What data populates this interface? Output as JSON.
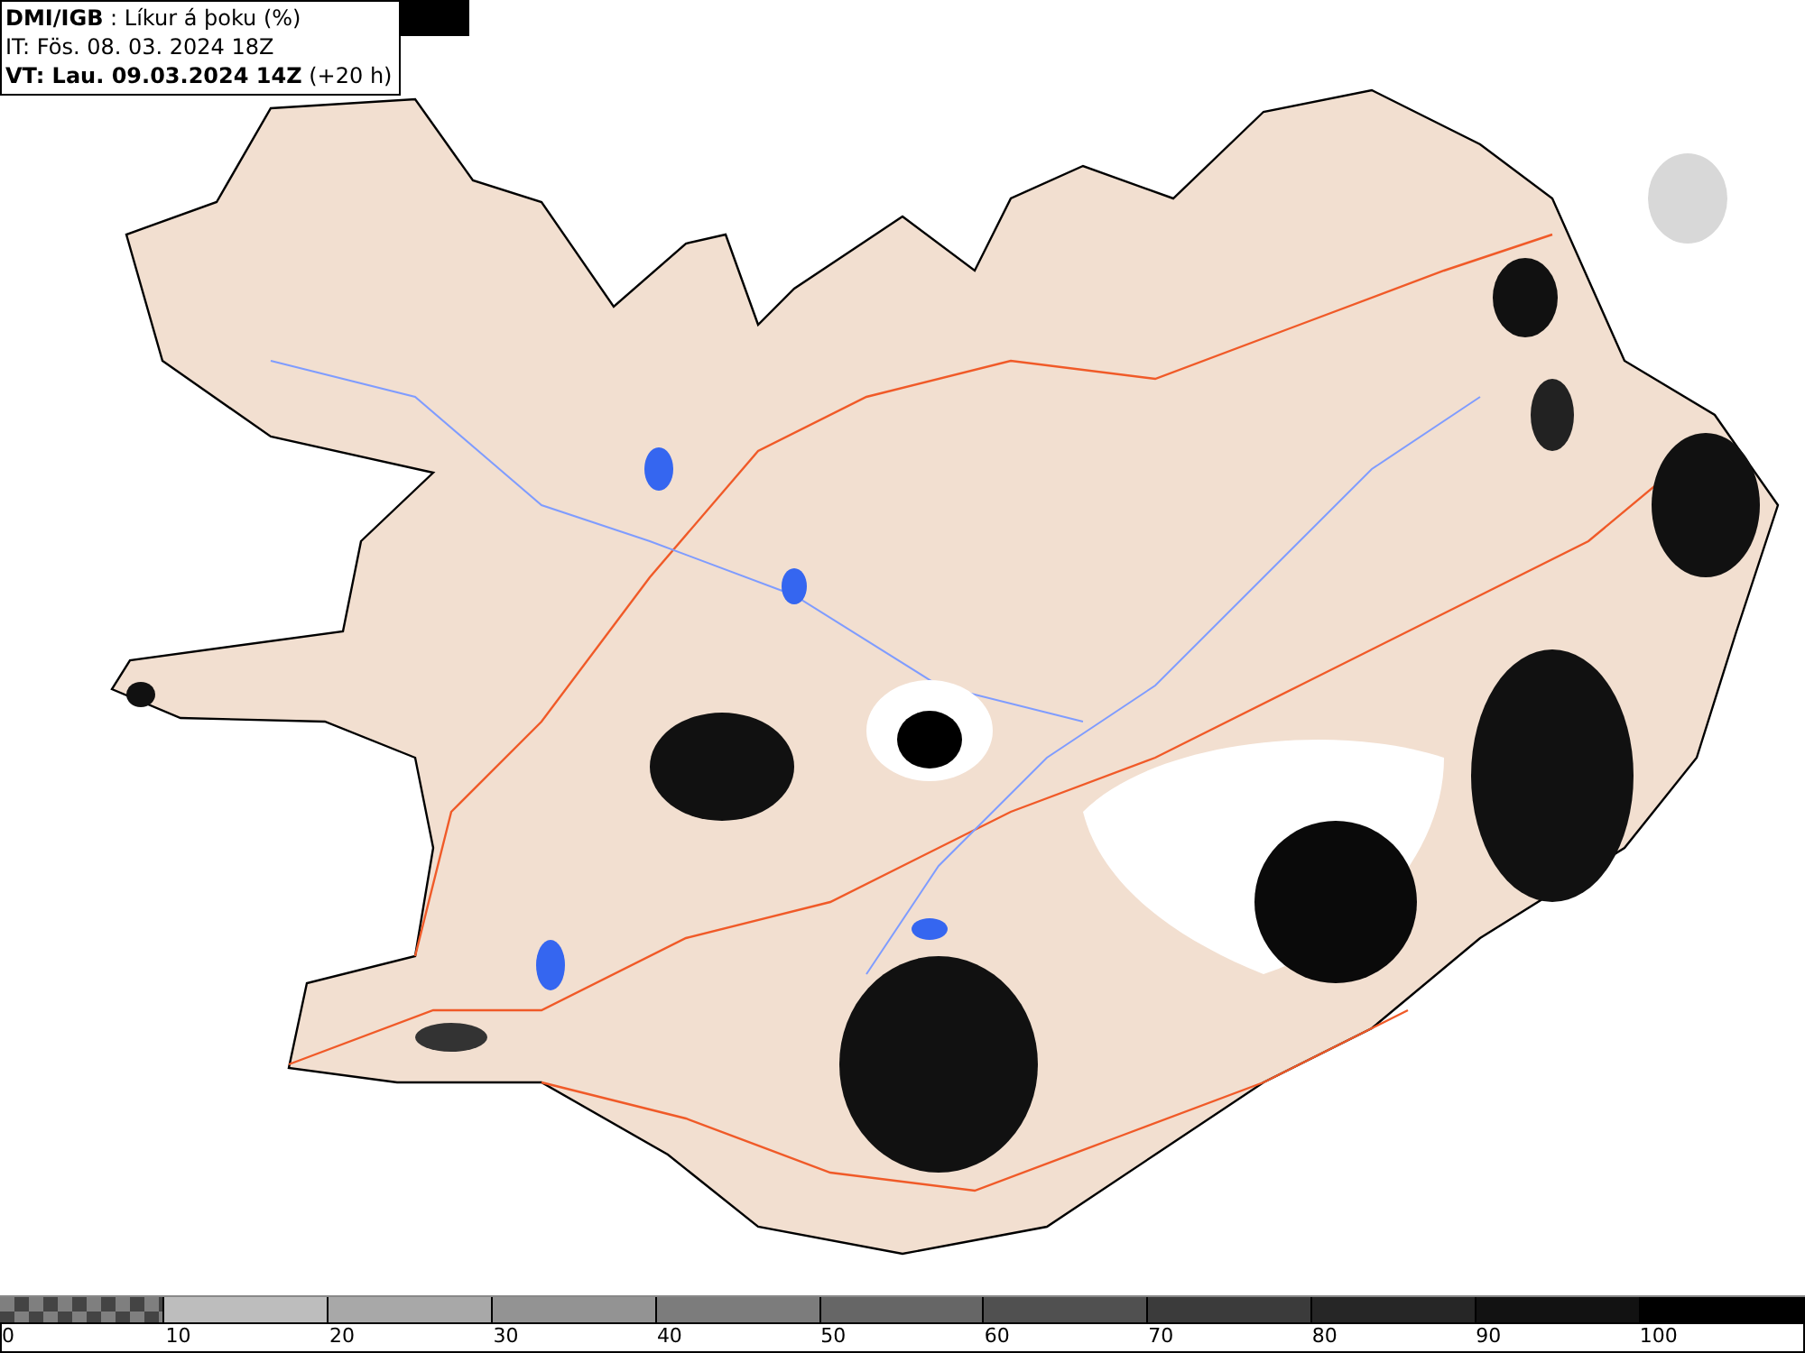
{
  "header": {
    "title": "**DMI/IGB** : Líkur á þoku (%)",
    "issue_time": "IT: Fös. 08. 03. 2024 18Z",
    "valid_time": "**VT: Lau. 09.03.2024 14Z** (+20 h)"
  },
  "legend": {
    "segments": [
      {
        "kind": "pattern",
        "color": "#7f7f7f"
      },
      {
        "kind": "solid",
        "color": "#bdbdbd"
      },
      {
        "kind": "solid",
        "color": "#a8a8a8"
      },
      {
        "kind": "solid",
        "color": "#939393"
      },
      {
        "kind": "solid",
        "color": "#7c7c7c"
      },
      {
        "kind": "solid",
        "color": "#666666"
      },
      {
        "kind": "solid",
        "color": "#505050"
      },
      {
        "kind": "solid",
        "color": "#3b3b3b"
      },
      {
        "kind": "solid",
        "color": "#262626"
      },
      {
        "kind": "solid",
        "color": "#121212"
      },
      {
        "kind": "solid",
        "color": "#000000"
      }
    ],
    "labels": [
      "0",
      "10",
      "20",
      "30",
      "40",
      "50",
      "60",
      "70",
      "80",
      "90",
      "100"
    ]
  }
}
